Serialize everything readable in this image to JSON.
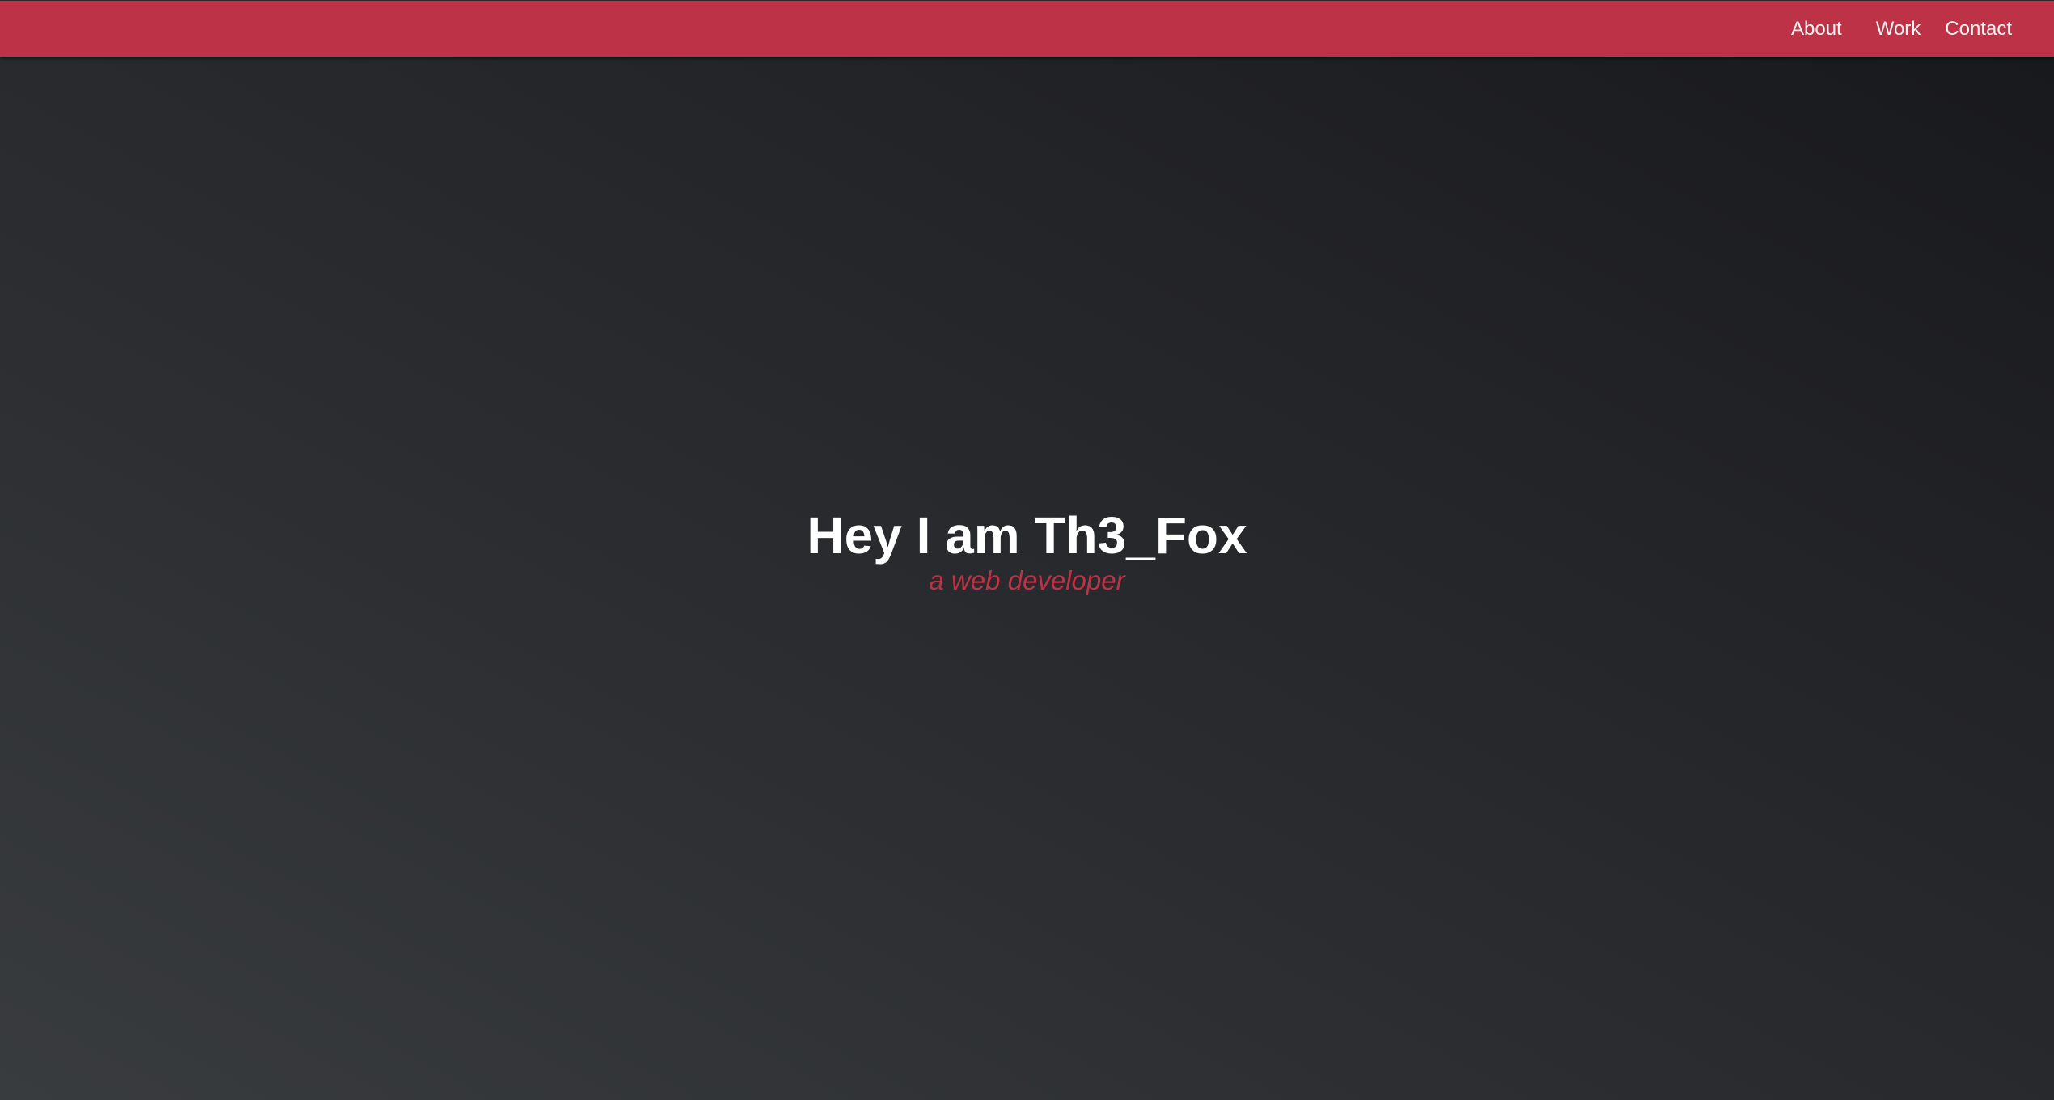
{
  "nav": {
    "links": [
      {
        "label": "About"
      },
      {
        "label": "Work"
      },
      {
        "label": "Contact"
      }
    ]
  },
  "hero": {
    "title": "Hey I am Th3_Fox",
    "subtitle": "a web developer"
  },
  "colors": {
    "accent": "#be3247",
    "background_light": "#393c3f",
    "background_dark": "#17181b",
    "text": "#ffffff"
  }
}
